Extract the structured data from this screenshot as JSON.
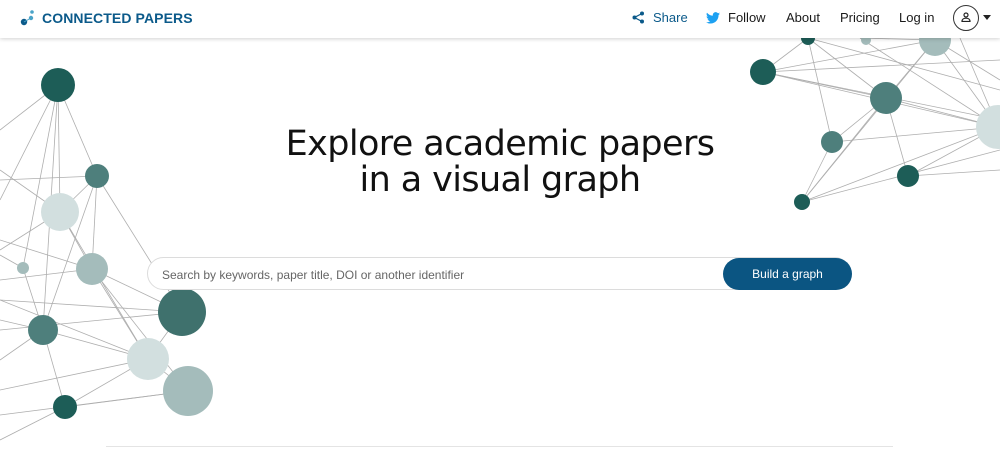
{
  "header": {
    "logo_text": "CONNECTED PAPERS",
    "nav": {
      "share": "Share",
      "follow": "Follow",
      "about": "About",
      "pricing": "Pricing",
      "login": "Log in"
    },
    "icons": {
      "share": "share-icon",
      "follow": "twitter-icon",
      "account": "user-icon",
      "menu": "caret-down-icon"
    }
  },
  "hero": {
    "title_line1": "Explore academic papers",
    "title_line2": "in a visual graph"
  },
  "search": {
    "placeholder": "Search by keywords, paper title, DOI or another identifier",
    "value": "",
    "button_label": "Build a graph"
  },
  "colors": {
    "brand": "#0b5a8a",
    "button": "#0b5582",
    "node_dark": "#1d5d57",
    "node_mid": "#4e7f7c",
    "node_light": "#d2dfdf"
  }
}
